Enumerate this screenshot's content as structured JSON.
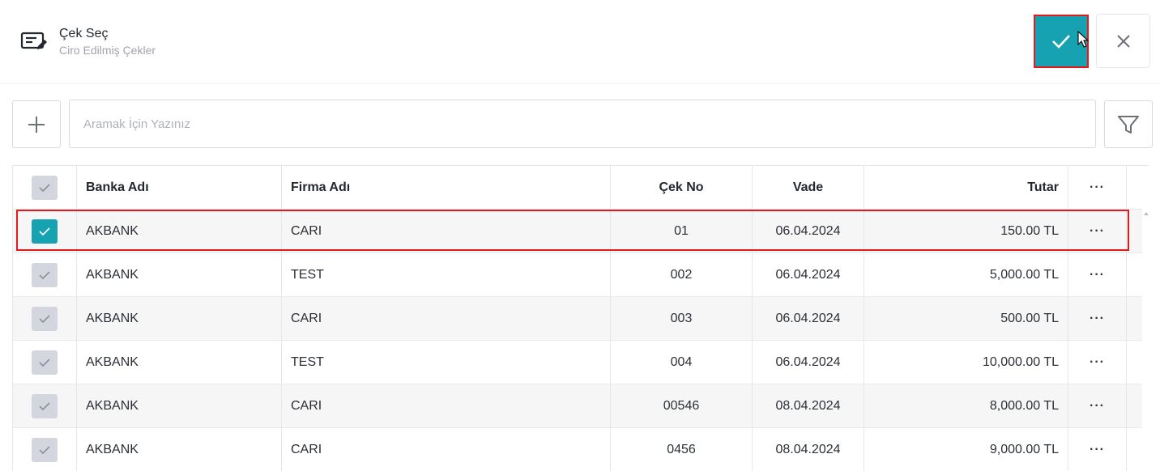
{
  "header": {
    "title": "Çek Seç",
    "subtitle": "Ciro Edilmiş Çekler"
  },
  "search": {
    "placeholder": "Aramak İçin Yazınız",
    "value": ""
  },
  "table": {
    "columns": {
      "bank": "Banka Adı",
      "firm": "Firma Adı",
      "no": "Çek No",
      "due": "Vade",
      "amount": "Tutar",
      "more": "···"
    },
    "rows": [
      {
        "bank": "AKBANK",
        "firm": "CARI",
        "no": "01",
        "due": "06.04.2024",
        "amount": "150.00 TL",
        "selected": true
      },
      {
        "bank": "AKBANK",
        "firm": "TEST",
        "no": "002",
        "due": "06.04.2024",
        "amount": "5,000.00 TL",
        "selected": false
      },
      {
        "bank": "AKBANK",
        "firm": "CARI",
        "no": "003",
        "due": "06.04.2024",
        "amount": "500.00 TL",
        "selected": false
      },
      {
        "bank": "AKBANK",
        "firm": "TEST",
        "no": "004",
        "due": "06.04.2024",
        "amount": "10,000.00 TL",
        "selected": false
      },
      {
        "bank": "AKBANK",
        "firm": "CARI",
        "no": "00546",
        "due": "08.04.2024",
        "amount": "8,000.00 TL",
        "selected": false
      },
      {
        "bank": "AKBANK",
        "firm": "CARI",
        "no": "0456",
        "due": "08.04.2024",
        "amount": "9,000.00 TL",
        "selected": false
      }
    ],
    "row_more": "···"
  },
  "colors": {
    "accent": "#17a2b2",
    "highlight": "#e11b1b",
    "checkbox_off": "#d3d6df"
  },
  "icons": {
    "header": "edit-list-icon",
    "confirm": "check-icon",
    "close": "close-icon",
    "add": "plus-icon",
    "filter": "filter-icon"
  }
}
